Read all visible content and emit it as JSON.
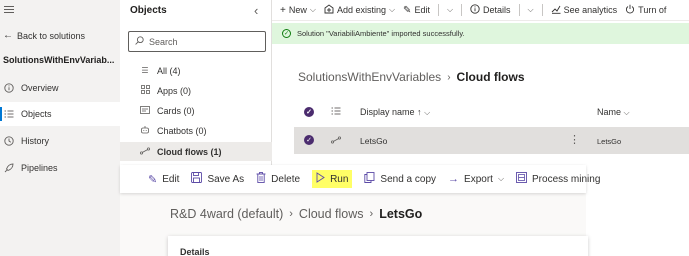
{
  "left_nav": {
    "back_label": "Back to solutions",
    "solution_name": "SolutionsWithEnvVariab...",
    "items": [
      {
        "label": "Overview",
        "icon": "info-icon"
      },
      {
        "label": "Objects",
        "icon": "list-icon"
      },
      {
        "label": "History",
        "icon": "history-icon"
      },
      {
        "label": "Pipelines",
        "icon": "rocket-icon"
      }
    ],
    "active": "Objects"
  },
  "objects_panel": {
    "title": "Objects",
    "search_placeholder": "Search",
    "items": [
      {
        "label": "All",
        "count": "(4)",
        "icon": "list-icon"
      },
      {
        "label": "Apps",
        "count": "(0)",
        "icon": "apps-icon"
      },
      {
        "label": "Cards",
        "count": "(0)",
        "icon": "card-icon"
      },
      {
        "label": "Chatbots",
        "count": "(0)",
        "icon": "bot-icon"
      },
      {
        "label": "Cloud flows",
        "count": "(1)",
        "icon": "flow-icon"
      }
    ],
    "active": "Cloud flows"
  },
  "command_bar": {
    "new": "New",
    "add_existing": "Add existing",
    "edit": "Edit",
    "details": "Details",
    "see_analytics": "See analytics",
    "turn_off": "Turn of"
  },
  "banner": {
    "message": "Solution \"VariabiliAmbiente\" imported successfully.",
    "color": "#dff6dd"
  },
  "main": {
    "breadcrumb_parent": "SolutionsWithEnvVariables",
    "breadcrumb_current": "Cloud flows",
    "columns": {
      "display_name": "Display name",
      "sort_indicator": "↑",
      "name": "Name"
    },
    "rows": [
      {
        "display_name": "LetsGo",
        "name": "LetsGo",
        "selected": true
      }
    ]
  },
  "flow_bar": {
    "edit": "Edit",
    "save_as": "Save As",
    "delete": "Delete",
    "run": "Run",
    "send_copy": "Send a copy",
    "export": "Export",
    "process_mining": "Process mining",
    "highlight_color": "#ffff66"
  },
  "flow_breadcrumb": {
    "env": "R&D 4ward (default)",
    "section": "Cloud flows",
    "current": "LetsGo"
  },
  "details_card": {
    "title": "Details"
  }
}
